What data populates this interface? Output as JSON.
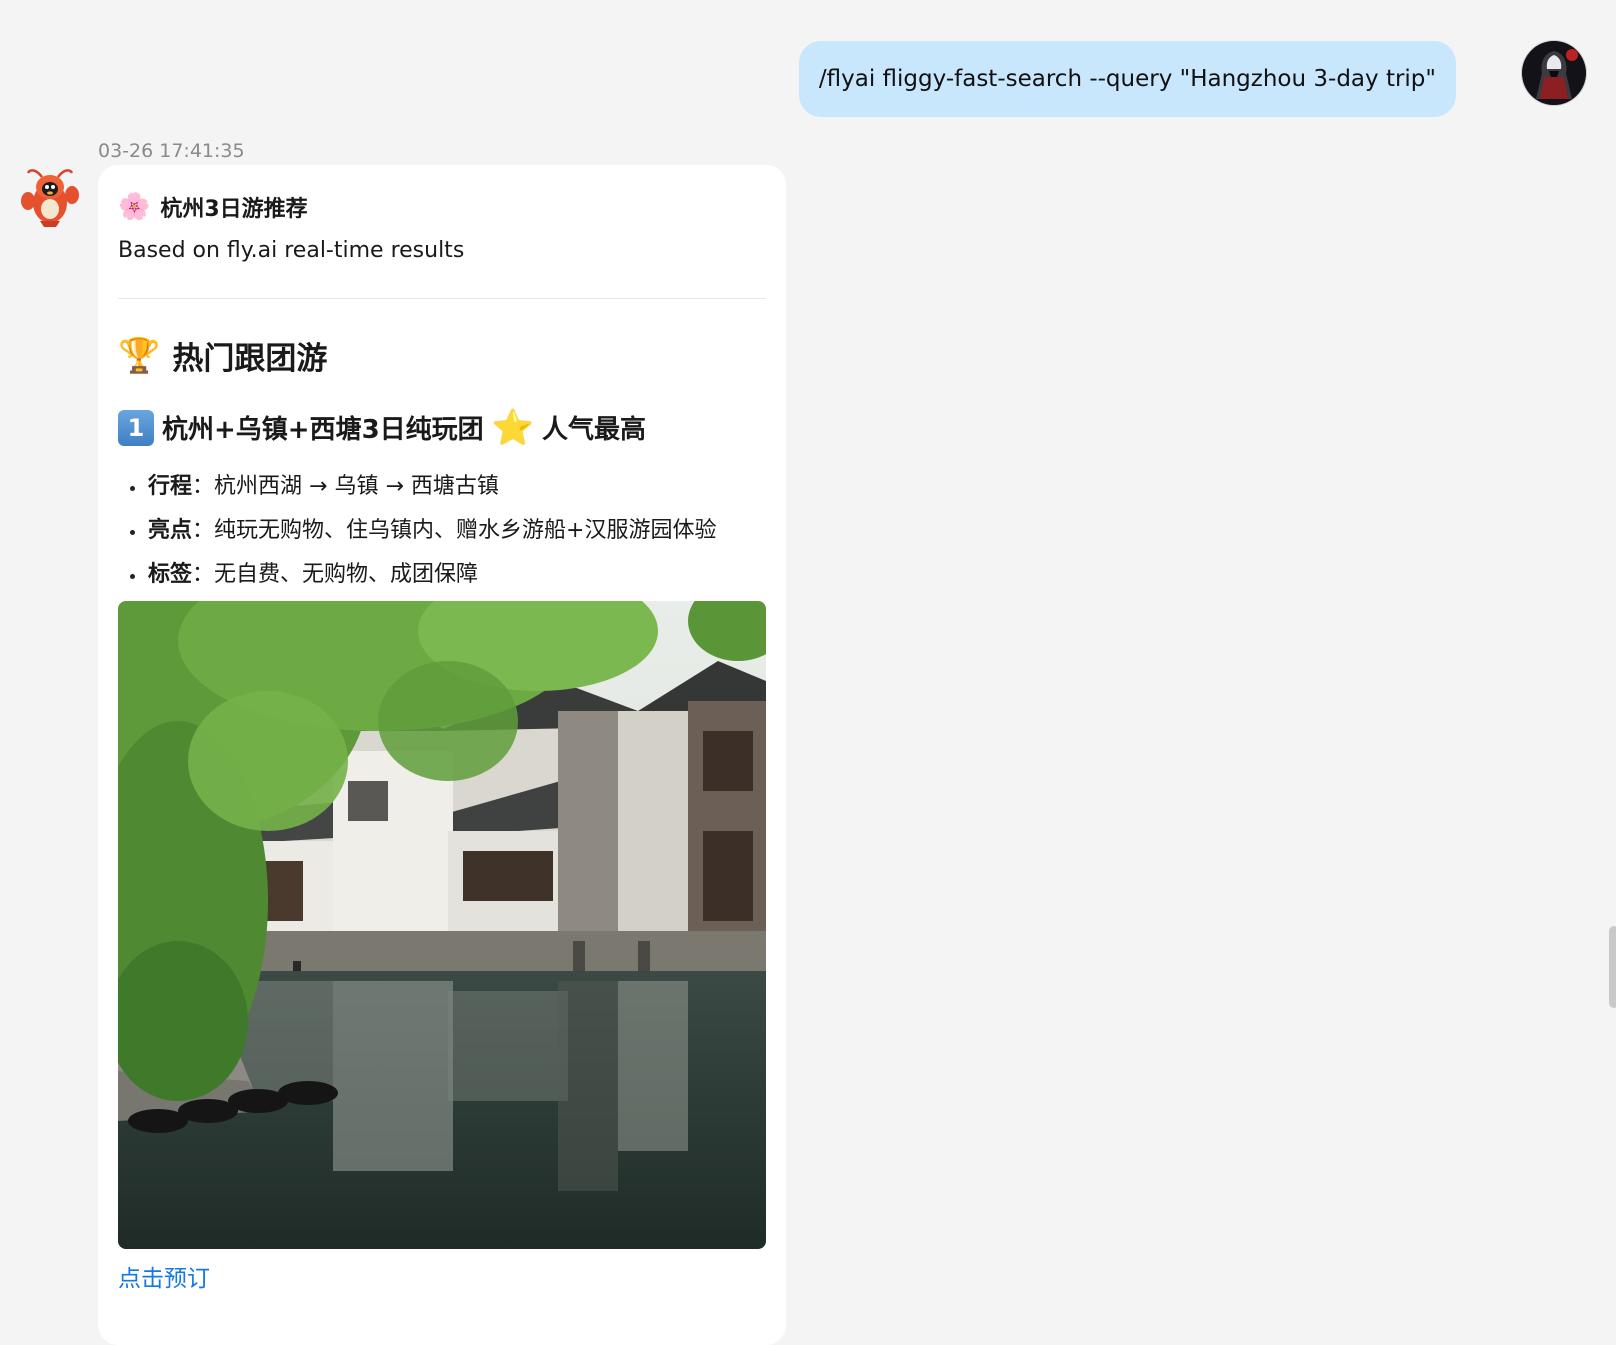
{
  "user_message": {
    "text": "/flyai fliggy-fast-search --query \"Hangzhou 3-day trip\""
  },
  "bot_message": {
    "timestamp": "03-26 17:41:35",
    "title_emoji": "🌸",
    "title": "杭州3日游推荐",
    "subtitle": "Based on fly.ai real-time results",
    "section_emoji": "🏆",
    "section_heading": "热门跟团游",
    "tour": {
      "number": "1",
      "name": "杭州+乌镇+西塘3日纯玩团",
      "badge_emoji": "⭐",
      "badge": "人气最高",
      "details": [
        {
          "key": "行程",
          "sep": "：",
          "value": "杭州西湖 → 乌镇 → 西塘古镇"
        },
        {
          "key": "亮点",
          "sep": "：",
          "value": "纯玩无购物、住乌镇内、赠水乡游船+汉服游园体验"
        },
        {
          "key": "标签",
          "sep": "：",
          "value": "无自费、无购物、成团保障"
        }
      ],
      "link": "点击预订"
    }
  },
  "colors": {
    "background": "#f4f4f4",
    "user_bubble": "#c8e6fc",
    "card": "#ffffff",
    "link": "#1677e6",
    "timestamp": "#8a8a8a"
  },
  "icons": {
    "user_avatar": "user-avatar-dark-hooded",
    "bot_avatar": "red-lobster-mascot",
    "title": "cherry-blossom-icon",
    "section": "trophy-icon",
    "number": "keycap-1-icon",
    "badge": "star-icon"
  }
}
